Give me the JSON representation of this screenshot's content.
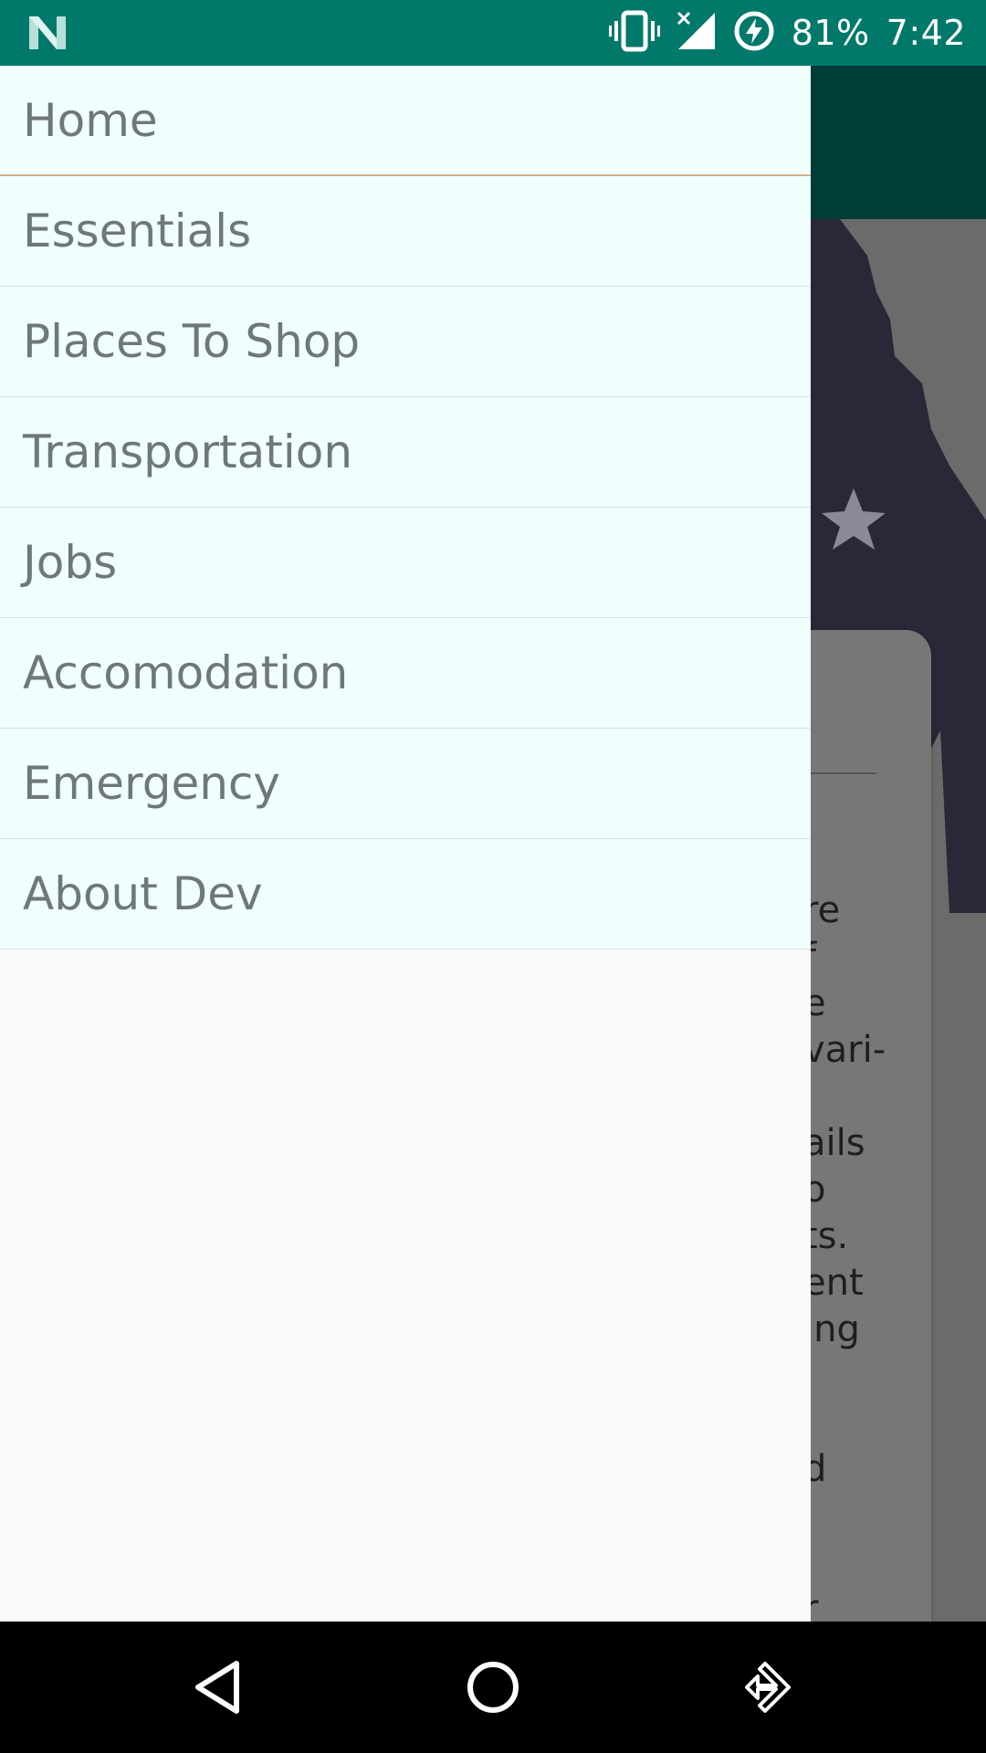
{
  "status_bar": {
    "battery_percent": "81%",
    "time": "7:42",
    "icons": [
      "notification-n-icon",
      "vibrate-icon",
      "signal-no-data-icon",
      "battery-charging-icon"
    ],
    "background_color": "#00796b"
  },
  "drawer": {
    "items": [
      {
        "label": "Home"
      },
      {
        "label": "Essentials"
      },
      {
        "label": "Places To Shop"
      },
      {
        "label": "Transportation"
      },
      {
        "label": "Jobs"
      },
      {
        "label": "Accomodation"
      },
      {
        "label": "Emergency"
      },
      {
        "label": "About Dev"
      }
    ],
    "item_background": "#f0fffe",
    "text_color": "#6f7777"
  },
  "background_card": {
    "text_fragments": [
      "re",
      "f",
      "e",
      "vari-",
      "l",
      "ails",
      "o",
      "ts.",
      "ent",
      "ing",
      "",
      "l",
      "d",
      "",
      "",
      "r",
      "."
    ]
  },
  "nav_bar": {
    "icons": [
      "back-icon",
      "home-icon",
      "rotate-icon"
    ]
  }
}
